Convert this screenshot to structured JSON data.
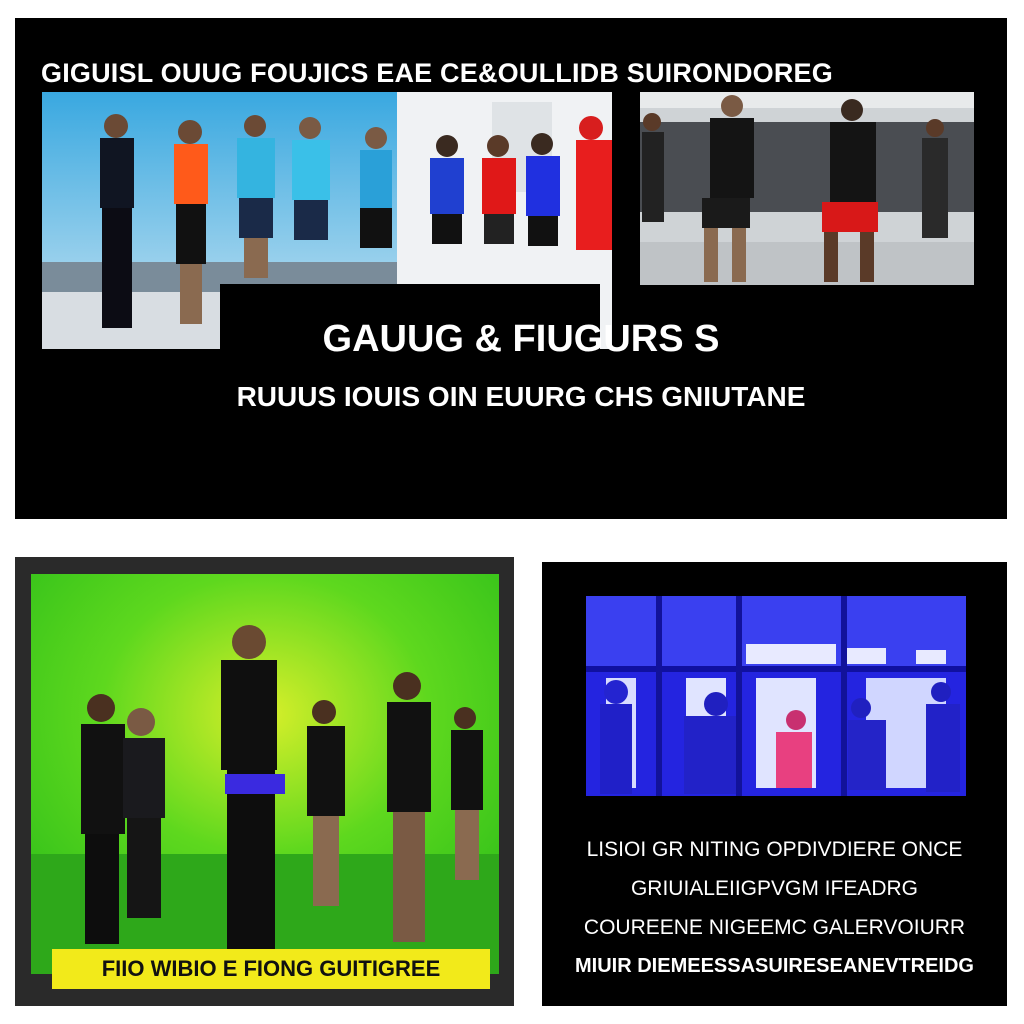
{
  "banner": {
    "title": "GIGUISL OUUG FOUJICS EAE  CE&OULLIDB  SUIRONDOREG"
  },
  "top_panel": {
    "headline": "GAUUG  & FIUGURS S",
    "subheadline": "RUUUS IOUIS OIN EUURG  CHS GNIUTANE"
  },
  "bottom_left": {
    "caption": "FIIO WIBIO E  FIONG  GUITIGREE"
  },
  "bottom_right": {
    "lines": [
      "LISIOI GR NITING OPDIVDIERE ONCE",
      "GRIUIALEIIGPVGM IFEADRG",
      "COUREENE NIGEEMC GALERVOIURR",
      "MIUIR DIEMEESSASUIRESEANEVTREIDG"
    ]
  },
  "colors": {
    "panel_bg": "#000000",
    "caption_bar": "#f2ea1a",
    "green_screen": "#3fd41a",
    "blue_scene": "#2020e8"
  }
}
